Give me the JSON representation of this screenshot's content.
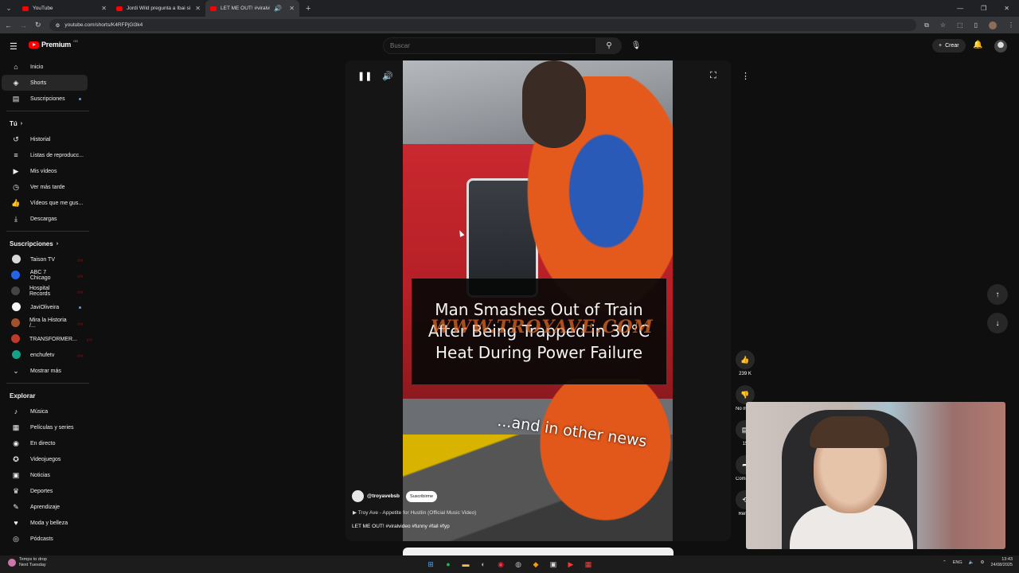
{
  "browser": {
    "tabs": [
      {
        "title": "YouTube",
        "active": false
      },
      {
        "title": "Jordi Wild pregunta a Ibai si es",
        "active": false
      },
      {
        "title": "LET ME OUT! #viralvideo #",
        "active": true
      }
    ],
    "url": "youtube.com/shorts/K4RFPjGl3k4"
  },
  "header": {
    "logo": "Premium",
    "logo_region": "GB",
    "search_placeholder": "Buscar",
    "create_label": "Crear"
  },
  "sidebar": {
    "main": [
      {
        "label": "Inicio",
        "icon": "home-icon",
        "glyph": "⌂"
      },
      {
        "label": "Shorts",
        "icon": "shorts-icon",
        "glyph": "◈",
        "active": true
      },
      {
        "label": "Suscripciones",
        "icon": "subscriptions-icon",
        "glyph": "▤",
        "dot": true
      }
    ],
    "you_title": "Tú",
    "you": [
      {
        "label": "Historial",
        "icon": "history-icon",
        "glyph": "↺"
      },
      {
        "label": "Listas de reproducc...",
        "icon": "playlists-icon",
        "glyph": "≡"
      },
      {
        "label": "Mis vídeos",
        "icon": "my-videos-icon",
        "glyph": "▶"
      },
      {
        "label": "Ver más tarde",
        "icon": "watch-later-icon",
        "glyph": "◷"
      },
      {
        "label": "Vídeos que me gus...",
        "icon": "liked-icon",
        "glyph": "👍"
      },
      {
        "label": "Descargas",
        "icon": "downloads-icon",
        "glyph": "⤓"
      }
    ],
    "subs_title": "Suscripciones",
    "subs": [
      {
        "label": "Taison TV",
        "color": "#d9d9d9",
        "badge": "live"
      },
      {
        "label": "ABC 7 Chicago",
        "color": "#2563eb",
        "badge": "live"
      },
      {
        "label": "Hospital Records",
        "color": "#444444",
        "badge": "live"
      },
      {
        "label": "JaviOliveira",
        "color": "#f5f5f5",
        "badge": "dot"
      },
      {
        "label": "Mira la Historia /...",
        "color": "#a0522d",
        "badge": "live"
      },
      {
        "label": "TRANSFORMER...",
        "color": "#c0392b",
        "badge": "live"
      },
      {
        "label": "enchufetv",
        "color": "#16a085",
        "badge": "live"
      }
    ],
    "show_more": "Mostrar más",
    "explore_title": "Explorar",
    "explore": [
      {
        "label": "Música",
        "icon": "music-icon",
        "glyph": "♪"
      },
      {
        "label": "Películas y series",
        "icon": "movies-icon",
        "glyph": "▦"
      },
      {
        "label": "En directo",
        "icon": "live-icon",
        "glyph": "◉"
      },
      {
        "label": "Videojuegos",
        "icon": "gaming-icon",
        "glyph": "✪"
      },
      {
        "label": "Noticias",
        "icon": "news-icon",
        "glyph": "▣"
      },
      {
        "label": "Deportes",
        "icon": "sports-icon",
        "glyph": "♛"
      },
      {
        "label": "Aprendizaje",
        "icon": "learning-icon",
        "glyph": "✎"
      },
      {
        "label": "Moda y belleza",
        "icon": "fashion-icon",
        "glyph": "♥"
      },
      {
        "label": "Pódcasts",
        "icon": "podcasts-icon",
        "glyph": "◎"
      }
    ]
  },
  "short": {
    "caption": "Man Smashes Out of Train After Being Trapped in 30°C Heat During Power Failure",
    "watermark": "WWW.TROYAVE.COM",
    "overlay_text": "...and in other news",
    "channel": "@troyavebsb",
    "subscribe_label": "Suscribirme",
    "music": "Troy Ave - Appetite for Hustlin (Official Music Video)",
    "description": "LET ME OUT! #viralvideo #funny #fail #fyp"
  },
  "actions": {
    "likes": "239 K",
    "dislike_label": "No me gusta",
    "comments": "15",
    "share_label": "Compartir",
    "remix_label": "Remix"
  },
  "taskbar": {
    "weather_line1": "Temps to drop",
    "weather_line2": "Next Tuesday",
    "lang": "ENG",
    "time": "13:43",
    "date": "24/08/2025"
  }
}
